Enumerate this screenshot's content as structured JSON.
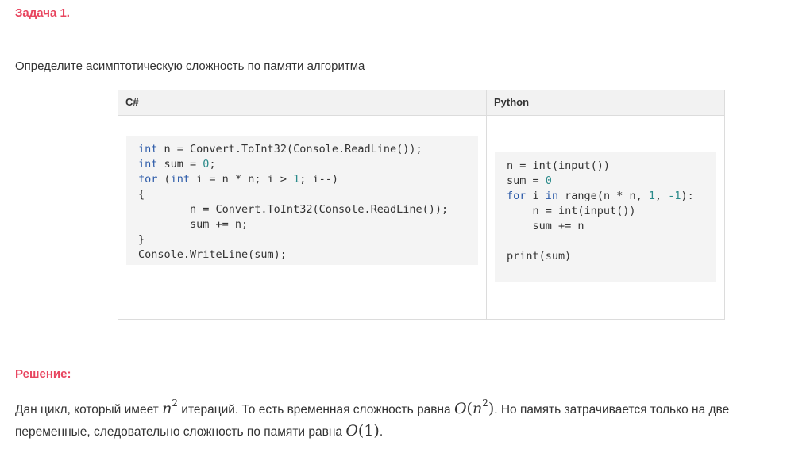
{
  "task": {
    "title": "Задача 1.",
    "question": "Определите асимптотическую сложность по памяти алгоритма"
  },
  "table": {
    "headers": {
      "csharp": "C#",
      "python": "Python"
    }
  },
  "code": {
    "csharp": {
      "l1": {
        "kw": "int",
        "text": " n = Convert.ToInt32(Console.ReadLine());"
      },
      "l2": {
        "kw": "int",
        "text": " sum = ",
        "num": "0",
        "tail": ";"
      },
      "l3": {
        "kw": "for",
        "a": " (",
        "kw2": "int",
        "b": " i = n * n; i > ",
        "num": "1",
        "c": "; i--)"
      },
      "l4": "{",
      "l5": "        n = Convert.ToInt32(Console.ReadLine());",
      "l6": "        sum += n;",
      "l7": "}",
      "l8": "Console.WriteLine(sum);"
    },
    "python": {
      "l1": "n = int(input())",
      "l2": {
        "text": "sum = ",
        "num": "0"
      },
      "l3": {
        "kw": "for",
        "a": " i ",
        "kw2": "in",
        "b": " range(n * n, ",
        "num1": "1",
        "c": ", ",
        "num2": "-1",
        "d": "):"
      },
      "l4": "    n = int(input())",
      "l5": "    sum += n",
      "l6": "",
      "l7": "print(sum)"
    }
  },
  "solution": {
    "title": "Решение:",
    "p1": "Дан цикл, который имеет ",
    "n_sym": "n",
    "n_exp": "2",
    "p2": " итераций. То есть временная сложность равна ",
    "o_sym": "O",
    "open": "(",
    "n_sym2": "n",
    "n_exp2": "2",
    "close": ")",
    "p3": ". Но память затрачивается только на две переменные, следовательно сложность по памяти равна ",
    "o_sym2": "O",
    "one": "(1)",
    "p4": "."
  },
  "colors": {
    "accent": "#e8455f",
    "keyword": "#2b5aa8",
    "number": "#2a8a8a",
    "code_bg": "#f4f4f4",
    "header_bg": "#f2f2f2"
  }
}
